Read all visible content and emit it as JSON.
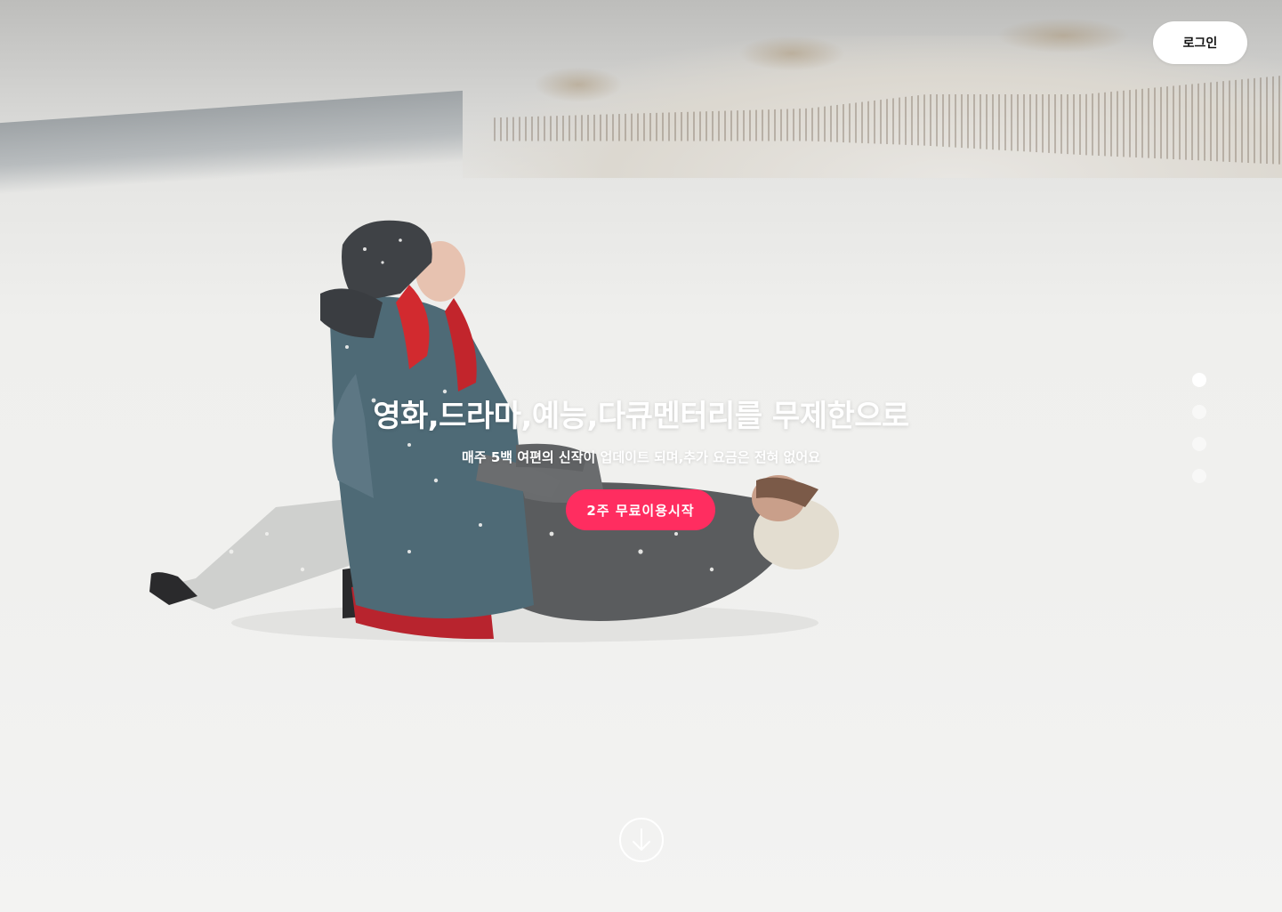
{
  "header": {
    "login_label": "로그인"
  },
  "hero": {
    "headline": "영화,드라마,예능,다큐멘터리를 무제한으로",
    "subheadline": "매주 5백 여편의 신작이 업데이트 되며,추가 요금은 전혀 없어요",
    "cta_label": "2주 무료이용시작",
    "background_image": "two people lying in the snow on a beach with dune fence"
  },
  "pagination": {
    "total": 4,
    "active_index": 0
  },
  "icons": {
    "scroll": "arrow-down-circle-icon"
  },
  "colors": {
    "accent": "#ff2d60",
    "button_bg": "#ffffff",
    "text": "#ffffff"
  }
}
